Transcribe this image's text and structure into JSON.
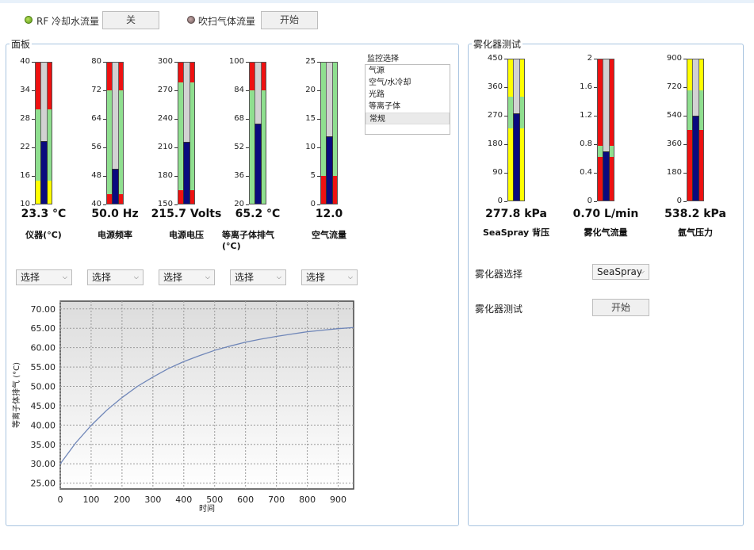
{
  "top": {
    "rf_label": "RF 冷却水流量",
    "rf_button": "关",
    "purge_label": "吹扫气体流量",
    "purge_button": "开始"
  },
  "panel": {
    "title": "面板",
    "monitor_label": "监控选择",
    "monitor_items": [
      "气源",
      "空气/水冷却",
      "光路",
      "等离子体",
      "常规"
    ],
    "monitor_selected": "常规",
    "select_placeholder": "选择",
    "gauges": [
      {
        "id": "instrument",
        "ticks": [
          "40",
          "34",
          "28",
          "22",
          "16",
          "10"
        ],
        "min": 10,
        "max": 40,
        "value": 23.3,
        "value_text": "23.3 °C",
        "name": "仪器(°C)",
        "zones": [
          {
            "from": 10,
            "to": 15,
            "color": "#ffff00"
          },
          {
            "from": 15,
            "to": 30,
            "color": "#8fdf8f"
          },
          {
            "from": 30,
            "to": 40,
            "color": "#ee1111"
          }
        ]
      },
      {
        "id": "freq",
        "ticks": [
          "80",
          "72",
          "64",
          "56",
          "48",
          "40"
        ],
        "min": 40,
        "max": 80,
        "value": 50.0,
        "value_text": "50.0 Hz",
        "name": "电源频率",
        "zones": [
          {
            "from": 40,
            "to": 43,
            "color": "#ee1111"
          },
          {
            "from": 43,
            "to": 72,
            "color": "#8fdf8f"
          },
          {
            "from": 72,
            "to": 80,
            "color": "#ee1111"
          }
        ]
      },
      {
        "id": "voltage",
        "ticks": [
          "300",
          "270",
          "240",
          "210",
          "180",
          "150"
        ],
        "min": 150,
        "max": 300,
        "value": 215.7,
        "value_text": "215.7 Volts",
        "name": "电源电压",
        "zones": [
          {
            "from": 150,
            "to": 165,
            "color": "#ee1111"
          },
          {
            "from": 165,
            "to": 278,
            "color": "#8fdf8f"
          },
          {
            "from": 278,
            "to": 300,
            "color": "#ee1111"
          }
        ]
      },
      {
        "id": "plasma",
        "ticks": [
          "100",
          "84",
          "68",
          "52",
          "36",
          "20"
        ],
        "min": 20,
        "max": 100,
        "value": 65.2,
        "value_text": "65.2 °C",
        "name": "等离子体排气 (°C)",
        "zones": [
          {
            "from": 20,
            "to": 84,
            "color": "#8fdf8f"
          },
          {
            "from": 84,
            "to": 100,
            "color": "#ee1111"
          }
        ]
      },
      {
        "id": "airflow",
        "ticks": [
          "25",
          "20",
          "15",
          "10",
          "5",
          "0"
        ],
        "min": 0,
        "max": 25,
        "value": 12.0,
        "value_text": "12.0",
        "name": "空气流量",
        "zones": [
          {
            "from": 0,
            "to": 5,
            "color": "#ee1111"
          },
          {
            "from": 5,
            "to": 25,
            "color": "#8fdf8f"
          }
        ]
      }
    ]
  },
  "nebulizer": {
    "title": "雾化器测试",
    "gauges": [
      {
        "id": "backpressure",
        "ticks": [
          "450",
          "360",
          "270",
          "180",
          "90",
          "0"
        ],
        "min": 0,
        "max": 450,
        "value": 277.8,
        "value_text": "277.8 kPa",
        "name": "SeaSpray 背压",
        "zones": [
          {
            "from": 0,
            "to": 230,
            "color": "#ffff00"
          },
          {
            "from": 230,
            "to": 330,
            "color": "#8fdf8f"
          },
          {
            "from": 330,
            "to": 450,
            "color": "#ffff00"
          }
        ]
      },
      {
        "id": "nebflow",
        "ticks": [
          "2",
          "1.6",
          "1.2",
          "0.8",
          "0.4",
          "0"
        ],
        "min": 0,
        "max": 2,
        "value": 0.7,
        "value_text": "0.70 L/min",
        "name": "雾化气流量",
        "zones": [
          {
            "from": 0,
            "to": 0.62,
            "color": "#ee1111"
          },
          {
            "from": 0.62,
            "to": 0.78,
            "color": "#8fdf8f"
          },
          {
            "from": 0.78,
            "to": 2,
            "color": "#ee1111"
          }
        ]
      },
      {
        "id": "argon",
        "ticks": [
          "900",
          "720",
          "540",
          "360",
          "180",
          "0"
        ],
        "min": 0,
        "max": 900,
        "value": 538.2,
        "value_text": "538.2 kPa",
        "name": "氩气压力",
        "zones": [
          {
            "from": 0,
            "to": 450,
            "color": "#ee1111"
          },
          {
            "from": 450,
            "to": 700,
            "color": "#8fdf8f"
          },
          {
            "from": 700,
            "to": 900,
            "color": "#ffff00"
          }
        ]
      }
    ],
    "select_label": "雾化器选择",
    "select_value": "SeaSpray",
    "test_label": "雾化器测试",
    "test_button": "开始"
  },
  "chart_data": {
    "type": "line",
    "xlabel": "时间",
    "ylabel": "等离子体排气 (°C)",
    "xlim": [
      0,
      950
    ],
    "ylim": [
      23.5,
      72
    ],
    "xticks": [
      0,
      100,
      200,
      300,
      400,
      500,
      600,
      700,
      800,
      900
    ],
    "yticks": [
      "25.00",
      "30.00",
      "35.00",
      "40.00",
      "45.00",
      "50.00",
      "55.00",
      "60.00",
      "65.00",
      "70.00"
    ],
    "grid": true,
    "series": [
      {
        "color": "#6f86b8",
        "x": [
          0,
          50,
          100,
          150,
          200,
          250,
          300,
          350,
          400,
          450,
          500,
          550,
          600,
          650,
          700,
          750,
          800,
          850,
          900,
          950
        ],
        "y": [
          30.0,
          35.4,
          39.9,
          43.8,
          47.1,
          50.0,
          52.4,
          54.6,
          56.4,
          57.9,
          59.3,
          60.4,
          61.4,
          62.2,
          62.9,
          63.5,
          64.1,
          64.5,
          64.9,
          65.2
        ]
      }
    ]
  }
}
